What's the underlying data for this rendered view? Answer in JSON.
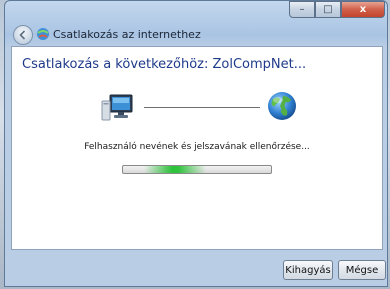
{
  "window": {
    "title": "Csatlakozás az internethez",
    "caption": {
      "minimize": "–",
      "maximize": "□",
      "close": "x"
    }
  },
  "main": {
    "heading": "Csatlakozás a következőhöz: ZolCompNet...",
    "status": "Felhasználó nevének és jelszavának ellenőrzése...",
    "progress": {
      "indeterminate": true,
      "glow_position": 0.35
    }
  },
  "footer": {
    "skip_label": "Kihagyás",
    "cancel_label": "Mégse"
  },
  "icons": {
    "back": "back-arrow-icon",
    "title": "network-icon",
    "computer": "computer-icon",
    "globe": "globe-icon"
  },
  "colors": {
    "heading": "#1e3a8a",
    "progress_glow": "#2fc23c",
    "close_button": "#c4442d"
  }
}
